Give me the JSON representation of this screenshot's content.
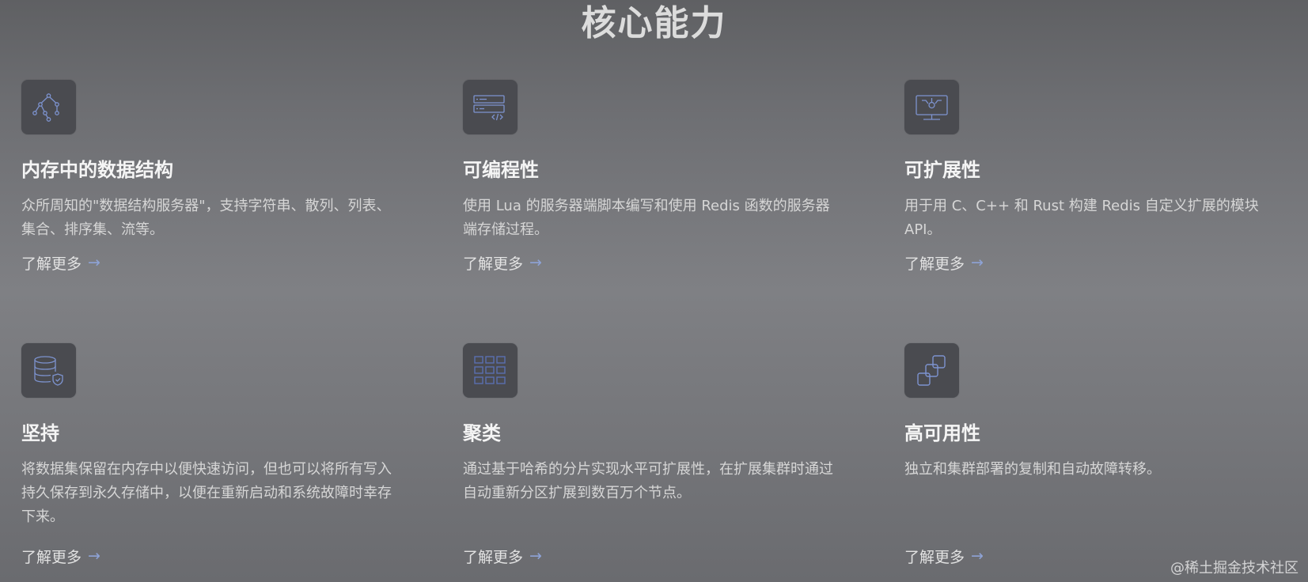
{
  "section": {
    "title": "核心能力"
  },
  "cards": [
    {
      "icon": "tree-structure-icon",
      "title": "内存中的数据结构",
      "description": "众所周知的\"数据结构服务器\"，支持字符串、散列、列表、集合、排序集、流等。",
      "link_label": "了解更多"
    },
    {
      "icon": "code-server-icon",
      "title": "可编程性",
      "description": "使用 Lua 的服务器端脚本编写和使用 Redis 函数的服务器端存储过程。",
      "link_label": "了解更多"
    },
    {
      "icon": "monitor-extension-icon",
      "title": "可扩展性",
      "description": "用于用 C、C++ 和 Rust 构建 Redis 自定义扩展的模块 API。",
      "link_label": "了解更多"
    },
    {
      "icon": "database-shield-icon",
      "title": "坚持",
      "description": "将数据集保留在内存中以便快速访问，但也可以将所有写入持久保存到永久存储中，以便在重新启动和系统故障时幸存下来。",
      "link_label": "了解更多"
    },
    {
      "icon": "cluster-grid-icon",
      "title": "聚类",
      "description": "通过基于哈希的分片实现水平可扩展性，在扩展集群时通过自动重新分区扩展到数百万个节点。",
      "link_label": "了解更多"
    },
    {
      "icon": "linked-squares-icon",
      "title": "高可用性",
      "description": "独立和集群部署的复制和自动故障转移。",
      "link_label": "了解更多"
    }
  ],
  "watermark": "@稀土掘金技术社区",
  "colors": {
    "icon_stroke": "#7d93cf",
    "arrow": "#8ea3d6",
    "icon_bg": "#4a4b50"
  }
}
